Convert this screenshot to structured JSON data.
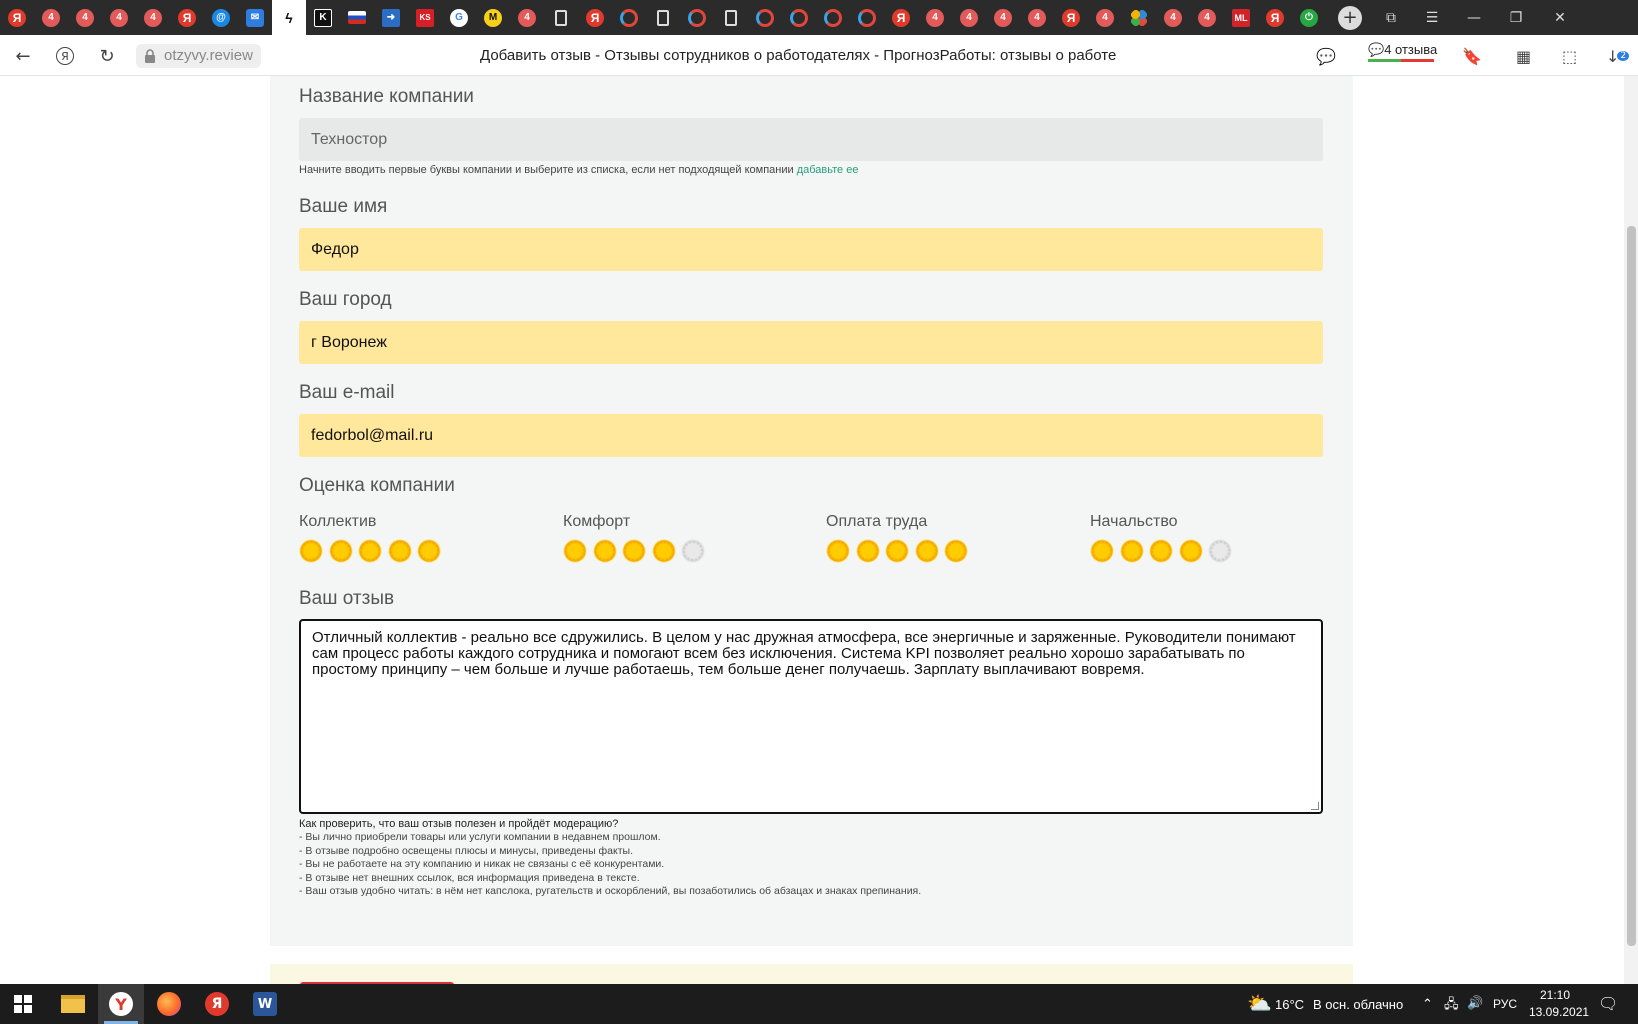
{
  "browser": {
    "tabs": [
      {
        "icon": "yandex-icon",
        "glyph": "Я"
      },
      {
        "icon": "four-icon",
        "glyph": "4"
      },
      {
        "icon": "four-icon",
        "glyph": "4"
      },
      {
        "icon": "four-icon",
        "glyph": "4"
      },
      {
        "icon": "four-icon",
        "glyph": "4"
      },
      {
        "icon": "yandex-icon",
        "glyph": "Я"
      },
      {
        "icon": "at-icon",
        "glyph": "@"
      },
      {
        "icon": "mail-icon",
        "glyph": "✉"
      },
      {
        "icon": "bolt-icon",
        "glyph": "ϟ",
        "active": true
      },
      {
        "icon": "k-icon",
        "glyph": "K"
      },
      {
        "icon": "flag-icon",
        "glyph": ""
      },
      {
        "icon": "arrow-icon",
        "glyph": "➜"
      },
      {
        "icon": "ks-icon",
        "glyph": "KS"
      },
      {
        "icon": "google-icon",
        "glyph": "G"
      },
      {
        "icon": "mw-icon",
        "glyph": "M"
      },
      {
        "icon": "four-icon",
        "glyph": "4"
      },
      {
        "icon": "doc-icon",
        "glyph": ""
      },
      {
        "icon": "yandex-icon",
        "glyph": "Я"
      },
      {
        "icon": "sync-icon",
        "glyph": ""
      },
      {
        "icon": "doc-icon",
        "glyph": ""
      },
      {
        "icon": "sync-icon",
        "glyph": ""
      },
      {
        "icon": "doc-icon",
        "glyph": ""
      },
      {
        "icon": "sync-icon",
        "glyph": ""
      },
      {
        "icon": "sync-icon",
        "glyph": ""
      },
      {
        "icon": "sync-icon",
        "glyph": ""
      },
      {
        "icon": "sync-icon",
        "glyph": ""
      },
      {
        "icon": "yandex-icon",
        "glyph": "Я"
      },
      {
        "icon": "four-icon",
        "glyph": "4"
      },
      {
        "icon": "four-icon",
        "glyph": "4"
      },
      {
        "icon": "four-icon",
        "glyph": "4"
      },
      {
        "icon": "four-icon",
        "glyph": "4"
      },
      {
        "icon": "yandex-icon",
        "glyph": "Я"
      },
      {
        "icon": "four-icon",
        "glyph": "4"
      },
      {
        "icon": "dots-icon",
        "glyph": ""
      },
      {
        "icon": "four-icon",
        "glyph": "4"
      },
      {
        "icon": "four-icon",
        "glyph": "4"
      },
      {
        "icon": "ml-icon",
        "glyph": "ML"
      },
      {
        "icon": "yandex-icon",
        "glyph": "Я"
      },
      {
        "icon": "power-icon",
        "glyph": "⏻"
      }
    ],
    "url": "otzyvy.review",
    "page_title": "Добавить отзыв - Отзывы сотрудников о работодателях - ПрогнозРаботы: отзывы о работе",
    "reviews_badge": "4 отзыва",
    "downloads_count": "2"
  },
  "form": {
    "company_label": "Название компании",
    "company_value": "Техностор",
    "company_hint": "Начните вводить первые буквы компании и выберите из списка, если нет подходящей компании",
    "company_hint_link": "дабавьте ее",
    "name_label": "Ваше имя",
    "name_value": "Федор",
    "city_label": "Ваш город",
    "city_value": "г Воронеж",
    "email_label": "Ваш e-mail",
    "email_value": "fedorbol@mail.ru",
    "rating_title": "Оценка компании",
    "ratings": [
      {
        "label": "Коллектив",
        "score": 5,
        "max": 5
      },
      {
        "label": "Комфорт",
        "score": 4,
        "max": 5
      },
      {
        "label": "Оплата труда",
        "score": 5,
        "max": 5
      },
      {
        "label": "Начальство",
        "score": 4,
        "max": 5
      }
    ],
    "review_label": "Ваш отзыв",
    "review_text": "Отличный коллектив - реально все сдружились. В целом у нас дружная атмосфера, все энергичные и заряженные. Руководители понимают сам процесс работы каждого сотрудника и помогают всем без исключения. Система KPI позволяет реально хорошо зарабатывать по простому принципу – чем больше и лучше работаешь, тем больше денег получаешь. Зарплату выплачивают вовремя.",
    "guide_title": "Как проверить, что ваш отзыв полезен и пройдёт модерацию?",
    "guide_items": [
      "- Вы лично приобрели товары или услуги компании в недавнем прошлом.",
      "- В отзыве подробно освещены плюсы и минусы, приведены факты.",
      "- Вы не работаете на эту компанию и никак не связаны с её конкурентами.",
      "- В отзыве нет внешних ссылок, вся информация приведена в тексте.",
      "- Ваш отзыв удобно читать: в нём нет капслока, ругательств и оскорблений, вы позаботились об абзацах и знаках препинания."
    ]
  },
  "taskbar": {
    "weather": "16°C",
    "weather_desc": "В осн. облачно",
    "lang": "РУС",
    "time": "21:10",
    "date": "13.09.2021"
  },
  "colors": {
    "field_yellow": "#ffe79c",
    "field_gray": "#e6e9e8",
    "panel_bg": "#f4f6f5",
    "link_green": "#2a9d7a",
    "sun_on": "#ffcc00",
    "sun_off": "#e9e9e9"
  }
}
